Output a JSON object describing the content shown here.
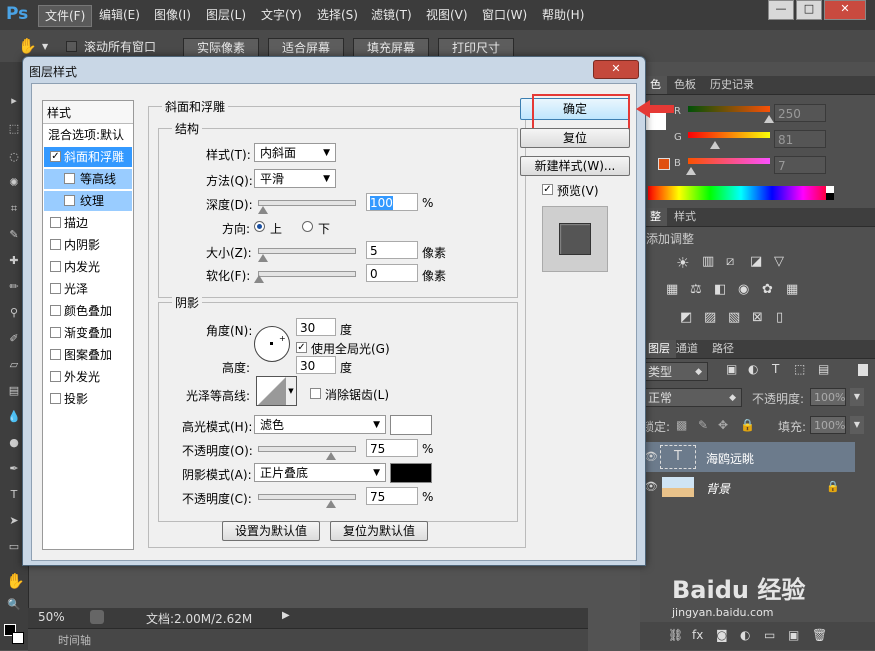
{
  "app": {
    "logo": "Ps",
    "menu": [
      "文件(F)",
      "编辑(E)",
      "图像(I)",
      "图层(L)",
      "文字(Y)",
      "选择(S)",
      "滤镜(T)",
      "视图(V)",
      "窗口(W)",
      "帮助(H)"
    ],
    "window_controls": {
      "minimize": "—",
      "restore": "□",
      "close": "✕"
    }
  },
  "options_bar": {
    "scroll_all_label": "滚动所有窗口",
    "buttons": [
      "实际像素",
      "适合屏幕",
      "填充屏幕",
      "打印尺寸"
    ]
  },
  "status": {
    "zoom": "50%",
    "doc": "文档:2.00M/2.62M"
  },
  "timeline": {
    "label": "时间轴"
  },
  "right_panel": {
    "color_tabs": [
      "色",
      "色板",
      "历史记录"
    ],
    "rgb": [
      {
        "ch": "R",
        "value": "250"
      },
      {
        "ch": "G",
        "value": "81"
      },
      {
        "ch": "B",
        "value": "7"
      }
    ],
    "adjust_tabs": [
      "整",
      "样式"
    ],
    "adjust_title": "添加调整",
    "layers_tabs": [
      "图层",
      "通道",
      "路径"
    ],
    "filter_kind": "类型",
    "blend_mode": "正常",
    "opacity_label": "不透明度:",
    "opacity_value": "100%",
    "lock_label": "锁定:",
    "fill_label": "填充:",
    "fill_value": "100%",
    "layers": [
      {
        "name": "海鸥远眺",
        "thumb": "T",
        "selected": true
      },
      {
        "name": "背景",
        "thumb": "",
        "selected": false
      }
    ]
  },
  "dialog": {
    "title": "图层样式",
    "close": "✕",
    "styles_header": "样式",
    "styles": [
      {
        "label": "混合选项:默认",
        "check": false,
        "state": "normal"
      },
      {
        "label": "斜面和浮雕",
        "check": true,
        "state": "selected"
      },
      {
        "label": "等高线",
        "check": false,
        "state": "sub"
      },
      {
        "label": "纹理",
        "check": false,
        "state": "sub"
      },
      {
        "label": "描边",
        "check": false,
        "state": "normal"
      },
      {
        "label": "内阴影",
        "check": false,
        "state": "normal"
      },
      {
        "label": "内发光",
        "check": false,
        "state": "normal"
      },
      {
        "label": "光泽",
        "check": false,
        "state": "normal"
      },
      {
        "label": "颜色叠加",
        "check": false,
        "state": "normal"
      },
      {
        "label": "渐变叠加",
        "check": false,
        "state": "normal"
      },
      {
        "label": "图案叠加",
        "check": false,
        "state": "normal"
      },
      {
        "label": "外发光",
        "check": false,
        "state": "normal"
      },
      {
        "label": "投影",
        "check": false,
        "state": "normal"
      }
    ],
    "bevel": {
      "group_title": "斜面和浮雕",
      "structure_title": "结构",
      "style_label": "样式(T):",
      "style_value": "内斜面",
      "technique_label": "方法(Q):",
      "technique_value": "平滑",
      "depth_label": "深度(D):",
      "depth_value": "100",
      "depth_unit": "%",
      "direction_label": "方向:",
      "dir_up": "上",
      "dir_down": "下",
      "size_label": "大小(Z):",
      "size_value": "5",
      "size_unit": "像素",
      "soften_label": "软化(F):",
      "soften_value": "0",
      "soften_unit": "像素"
    },
    "shading": {
      "title": "阴影",
      "angle_label": "角度(N):",
      "angle_value": "30",
      "angle_unit": "度",
      "global_light_label": "使用全局光(G)",
      "altitude_label": "高度:",
      "altitude_value": "30",
      "altitude_unit": "度",
      "gloss_label": "光泽等高线:",
      "antialias_label": "消除锯齿(L)",
      "highlight_mode_label": "高光模式(H):",
      "highlight_mode_value": "滤色",
      "highlight_color": "#ffffff",
      "opacity1_label": "不透明度(O):",
      "opacity1_value": "75",
      "opacity_unit": "%",
      "shadow_mode_label": "阴影模式(A):",
      "shadow_mode_value": "正片叠底",
      "shadow_color": "#000000",
      "opacity2_label": "不透明度(C):",
      "opacity2_value": "75"
    },
    "default_btn": "设置为默认值",
    "reset_default_btn": "复位为默认值",
    "ok_btn": "确定",
    "reset_btn": "复位",
    "new_style_btn": "新建样式(W)...",
    "preview_label": "预览(V)"
  },
  "colors": {
    "highlight_box": "#e53935",
    "arrow": "#e53935",
    "selection": "#3399ff"
  }
}
